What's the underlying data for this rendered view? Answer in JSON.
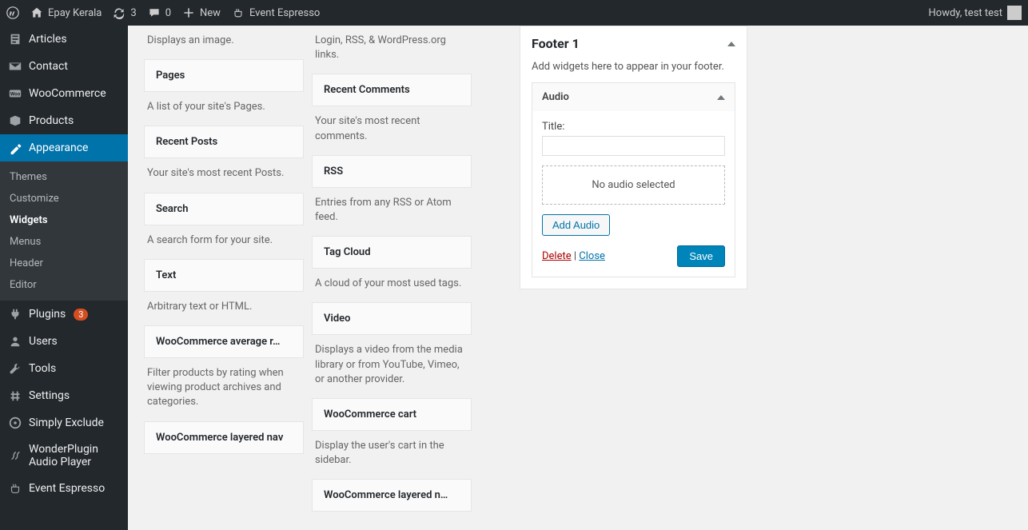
{
  "adminbar": {
    "site_name": "Epay Kerala",
    "updates_count": "3",
    "comments_count": "0",
    "new_label": "New",
    "extra_item": "Event Espresso",
    "howdy": "Howdy, test test"
  },
  "sidebar": {
    "items": [
      {
        "label": "Articles"
      },
      {
        "label": "Contact"
      },
      {
        "label": "WooCommerce"
      },
      {
        "label": "Products"
      },
      {
        "label": "Appearance",
        "active": true
      },
      {
        "label": "Plugins",
        "badge": "3"
      },
      {
        "label": "Users"
      },
      {
        "label": "Tools"
      },
      {
        "label": "Settings"
      },
      {
        "label": "Simply Exclude"
      },
      {
        "label": "WonderPlugin Audio Player"
      },
      {
        "label": "Event Espresso"
      }
    ],
    "submenu": [
      {
        "label": "Themes"
      },
      {
        "label": "Customize"
      },
      {
        "label": "Widgets",
        "current": true
      },
      {
        "label": "Menus"
      },
      {
        "label": "Header"
      },
      {
        "label": "Editor"
      }
    ]
  },
  "widgets": {
    "left": [
      {
        "desc": "Displays an image."
      },
      {
        "title": "Pages",
        "desc": "A list of your site's Pages."
      },
      {
        "title": "Recent Posts",
        "desc": "Your site's most recent Posts."
      },
      {
        "title": "Search",
        "desc": "A search form for your site."
      },
      {
        "title": "Text",
        "desc": "Arbitrary text or HTML."
      },
      {
        "title": "WooCommerce average r…",
        "desc": "Filter products by rating when viewing product archives and categories."
      },
      {
        "title": "WooCommerce layered nav"
      }
    ],
    "right": [
      {
        "desc": "Login, RSS, & WordPress.org links."
      },
      {
        "title": "Recent Comments",
        "desc": "Your site's most recent comments."
      },
      {
        "title": "RSS",
        "desc": "Entries from any RSS or Atom feed."
      },
      {
        "title": "Tag Cloud",
        "desc": "A cloud of your most used tags."
      },
      {
        "title": "Video",
        "desc": "Displays a video from the media library or from YouTube, Vimeo, or another provider."
      },
      {
        "title": "WooCommerce cart",
        "desc": "Display the user's cart in the sidebar."
      },
      {
        "title": "WooCommerce layered n…"
      }
    ]
  },
  "footer_area": {
    "title": "Footer 1",
    "desc": "Add widgets here to appear in your footer.",
    "widget": {
      "name": "Audio",
      "title_label": "Title:",
      "title_value": "",
      "placeholder": "No audio selected",
      "add_btn": "Add Audio",
      "delete": "Delete",
      "close": "Close",
      "save": "Save"
    }
  }
}
